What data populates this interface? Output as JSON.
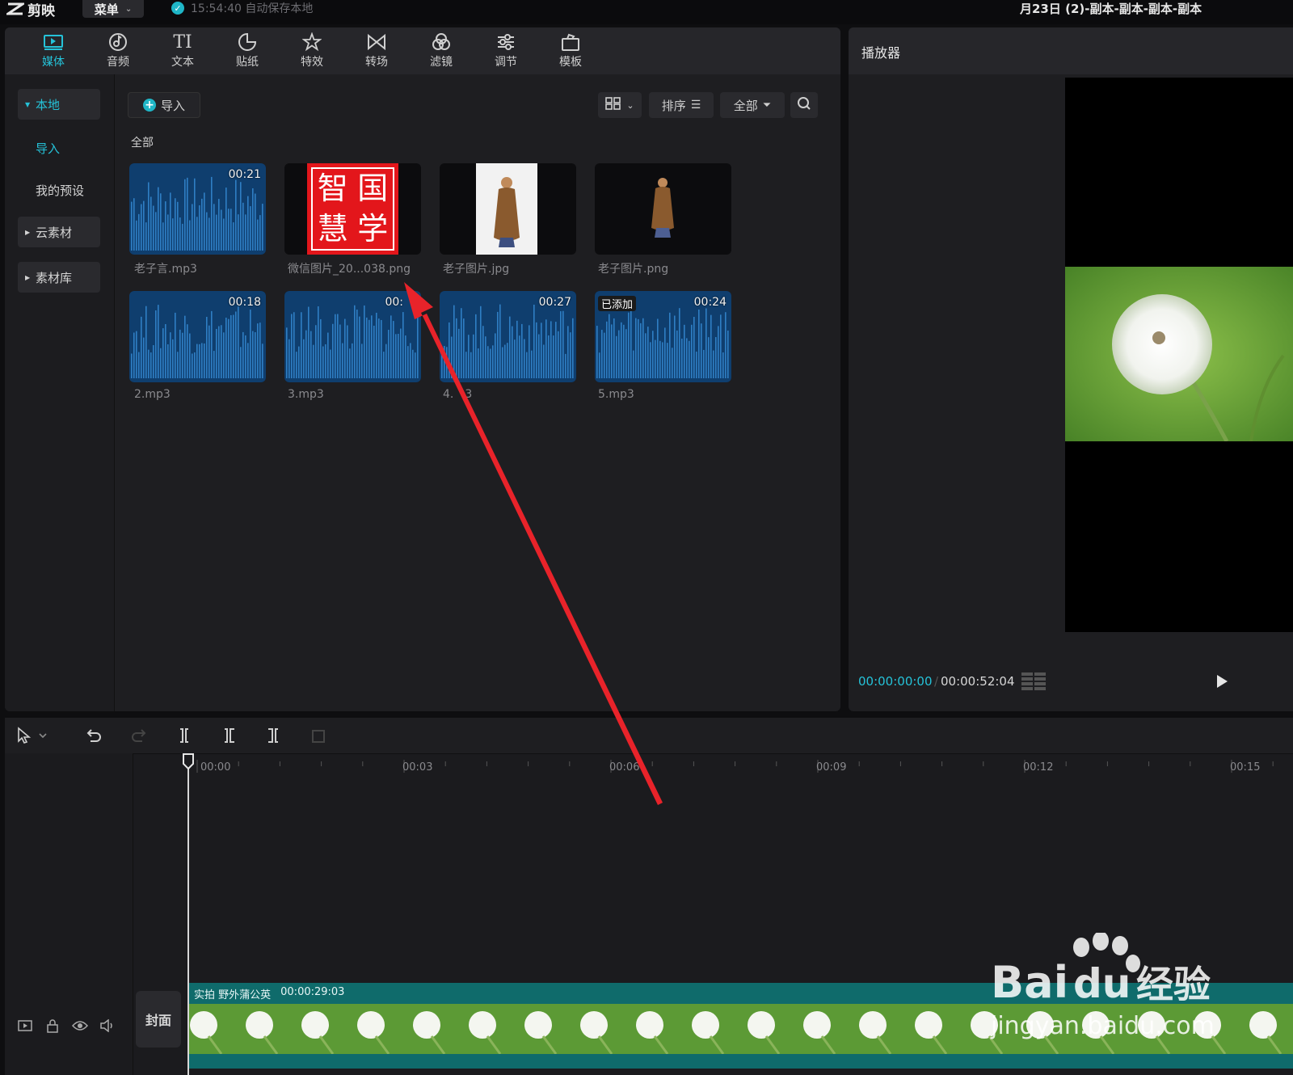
{
  "app": {
    "name": "剪映",
    "menu_label": "菜单",
    "autosave_text": "15:54:40 自动保存本地",
    "project_title": "月23日 (2)-副本-副本-副本-副本"
  },
  "tabs": [
    {
      "label": "媒体",
      "icon": "media-icon",
      "active": true
    },
    {
      "label": "音频",
      "icon": "audio-icon"
    },
    {
      "label": "文本",
      "icon": "text-icon"
    },
    {
      "label": "贴纸",
      "icon": "sticker-icon"
    },
    {
      "label": "特效",
      "icon": "effects-icon"
    },
    {
      "label": "转场",
      "icon": "transition-icon"
    },
    {
      "label": "滤镜",
      "icon": "filter-icon"
    },
    {
      "label": "调节",
      "icon": "adjust-icon"
    },
    {
      "label": "模板",
      "icon": "template-icon"
    }
  ],
  "side_nav": {
    "local": "本地",
    "import": "导入",
    "presets": "我的预设",
    "cloud": "云素材",
    "library": "素材库"
  },
  "toolbar": {
    "import_label": "导入",
    "sort_label": "排序",
    "filter_label": "全部"
  },
  "section_label": "全部",
  "media_items": [
    {
      "name": "老子言.mp3",
      "duration": "00:21",
      "type": "audio"
    },
    {
      "name": "微信图片_20...038.png",
      "type": "image",
      "seal_chars": "国智学慧"
    },
    {
      "name": "老子图片.jpg",
      "type": "image"
    },
    {
      "name": "老子图片.png",
      "type": "image"
    },
    {
      "name": "2.mp3",
      "duration": "00:18",
      "type": "audio"
    },
    {
      "name": "3.mp3",
      "duration": "00:",
      "type": "audio"
    },
    {
      "name": "4.",
      "name_tail": "3",
      "duration": "00:27",
      "type": "audio"
    },
    {
      "name": "5.mp3",
      "duration": "00:24",
      "type": "audio",
      "badge": "已添加"
    }
  ],
  "player": {
    "title": "播放器",
    "current_time": "00:00:00:00",
    "separator": "/",
    "total_time": "00:00:52:04"
  },
  "timeline": {
    "ruler_labels": [
      "00:00",
      "00:03",
      "00:06",
      "00:09",
      "00:12",
      "00:15"
    ],
    "cover_label": "封面",
    "clip_name": "实拍 野外蒲公英",
    "clip_duration": "00:00:29:03"
  },
  "watermark": {
    "brand": "Bai",
    "brand_tail": "经验",
    "url": "jingyan.baidu.com"
  },
  "colors": {
    "accent": "#25c2d8",
    "panel": "#1e1e21",
    "clip": "#0f6b6b",
    "audio_wave": "#2f7fc4",
    "annotation_arrow": "#e8232a"
  }
}
